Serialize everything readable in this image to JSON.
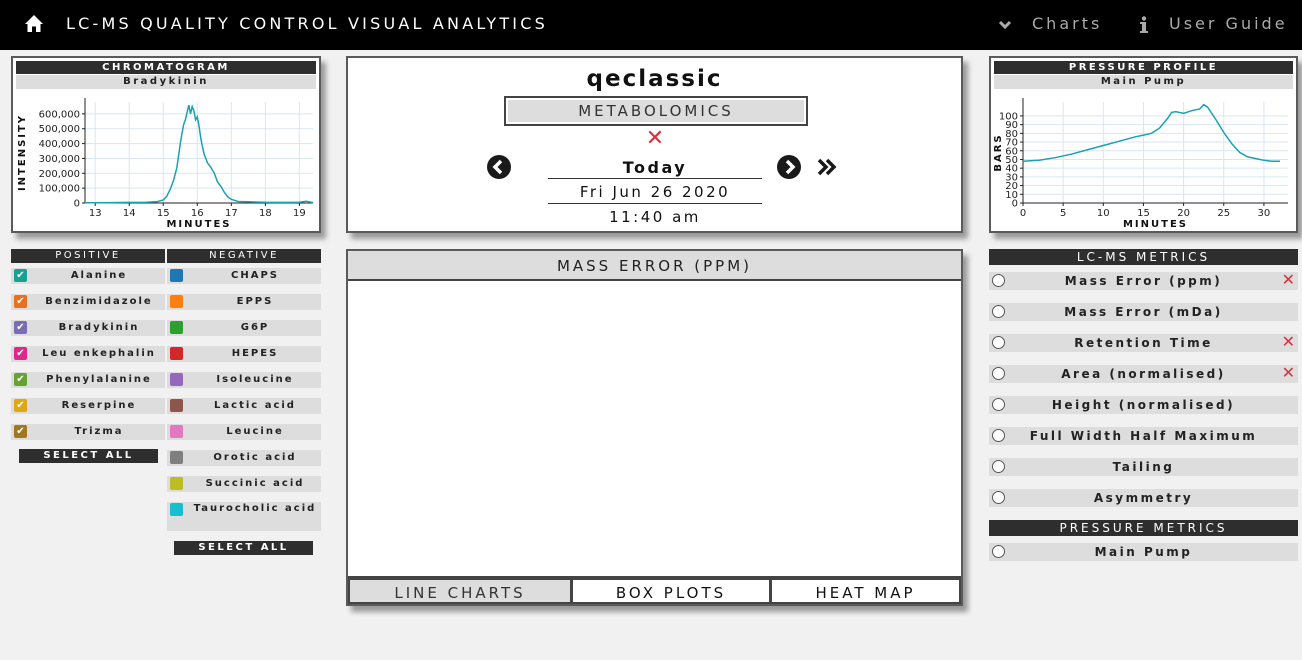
{
  "topbar": {
    "title": "LC-MS QUALITY CONTROL VISUAL ANALYTICS",
    "charts_label": "Charts",
    "guide_label": "User Guide"
  },
  "chromatogram": {
    "title": "CHROMATOGRAM",
    "compound": "Bradykinin",
    "ylabel": "INTENSITY",
    "xlabel": "MINUTES"
  },
  "pressure": {
    "title": "PRESSURE PROFILE",
    "subtitle": "Main Pump",
    "ylabel": "BARS",
    "xlabel": "MINUTES"
  },
  "run": {
    "name": "qeclassic",
    "mode": "METABOLOMICS",
    "day": "Today",
    "date": "Fri Jun 26 2020",
    "time": "11:40 am"
  },
  "lists": {
    "positive_title": "POSITIVE",
    "negative_title": "NEGATIVE",
    "select_all": "SELECT ALL",
    "positive": [
      {
        "label": "Alanine",
        "color": "#17a195",
        "checked": true
      },
      {
        "label": "Benzimidazole",
        "color": "#e8701e",
        "checked": true
      },
      {
        "label": "Bradykinin",
        "color": "#7a6cb5",
        "checked": true
      },
      {
        "label": "Leu enkephalin",
        "color": "#e0288c",
        "checked": true
      },
      {
        "label": "Phenylalanine",
        "color": "#66a232",
        "checked": true
      },
      {
        "label": "Reserpine",
        "color": "#e2a614",
        "checked": true
      },
      {
        "label": "Trizma",
        "color": "#a2781e",
        "checked": true
      }
    ],
    "negative": [
      {
        "label": "CHAPS",
        "color": "#1f77b4"
      },
      {
        "label": "EPPS",
        "color": "#ff7f0e"
      },
      {
        "label": "G6P",
        "color": "#2ca02c"
      },
      {
        "label": "HEPES",
        "color": "#d62728"
      },
      {
        "label": "Isoleucine",
        "color": "#9467bd"
      },
      {
        "label": "Lactic acid",
        "color": "#8c564b"
      },
      {
        "label": "Leucine",
        "color": "#e377c2"
      },
      {
        "label": "Orotic acid",
        "color": "#7f7f7f"
      },
      {
        "label": "Succinic acid",
        "color": "#bcbd22"
      },
      {
        "label": "Taurocholic acid",
        "color": "#17becf"
      }
    ]
  },
  "mass_error": {
    "title": "MASS ERROR (PPM)",
    "tabs": [
      "LINE CHARTS",
      "BOX PLOTS",
      "HEAT MAP"
    ],
    "active_tab": "LINE CHARTS"
  },
  "metrics": {
    "title": "LC-MS METRICS",
    "items": [
      {
        "label": "Mass Error (ppm)",
        "flag": true
      },
      {
        "label": "Mass Error (mDa)",
        "flag": false
      },
      {
        "label": "Retention Time",
        "flag": true
      },
      {
        "label": "Area (normalised)",
        "flag": true
      },
      {
        "label": "Height (normalised)",
        "flag": false
      },
      {
        "label": "Full Width Half Maximum",
        "flag": false
      },
      {
        "label": "Tailing",
        "flag": false
      },
      {
        "label": "Asymmetry",
        "flag": false
      }
    ],
    "pressure_title": "PRESSURE METRICS",
    "pressure_items": [
      {
        "label": "Main Pump"
      }
    ]
  },
  "chart_data": [
    {
      "type": "line",
      "title": "CHROMATOGRAM",
      "subtitle": "Bradykinin",
      "xlabel": "MINUTES",
      "ylabel": "INTENSITY",
      "xlim": [
        12.7,
        19.4
      ],
      "ylim": [
        0,
        680000
      ],
      "xticks": [
        13,
        14,
        15,
        16,
        17,
        18,
        19
      ],
      "yticks": [
        0,
        100000,
        200000,
        300000,
        400000,
        500000,
        600000
      ],
      "yticklabels": [
        "0",
        "100,000",
        "200,000",
        "300,000",
        "400,000",
        "500,000",
        "600,000"
      ],
      "color": "#1aa1b2",
      "grid": true,
      "series": [
        {
          "x": [
            12.7,
            13.0,
            13.5,
            14.0,
            14.5,
            14.8,
            15.0,
            15.1,
            15.2,
            15.3,
            15.4,
            15.45,
            15.5,
            15.55,
            15.6,
            15.65,
            15.7,
            15.75,
            15.8,
            15.85,
            15.9,
            15.95,
            16.0,
            16.05,
            16.1,
            16.15,
            16.2,
            16.3,
            16.4,
            16.5,
            16.6,
            16.7,
            16.8,
            16.9,
            17.0,
            17.2,
            17.5,
            18.0,
            18.5,
            19.0,
            19.2,
            19.4
          ],
          "y": [
            2000,
            2000,
            3000,
            4000,
            5000,
            8000,
            20000,
            45000,
            90000,
            150000,
            240000,
            320000,
            400000,
            470000,
            530000,
            560000,
            610000,
            660000,
            600000,
            650000,
            620000,
            560000,
            580000,
            520000,
            440000,
            380000,
            330000,
            270000,
            240000,
            200000,
            140000,
            110000,
            70000,
            40000,
            25000,
            10000,
            8000,
            5000,
            4000,
            5000,
            12000,
            3000
          ]
        }
      ]
    },
    {
      "type": "line",
      "title": "PRESSURE PROFILE",
      "subtitle": "Main Pump",
      "xlabel": "MINUTES",
      "ylabel": "BARS",
      "xlim": [
        0,
        33
      ],
      "ylim": [
        0,
        116
      ],
      "xticks": [
        0,
        5,
        10,
        15,
        20,
        25,
        30
      ],
      "yticks": [
        0,
        10,
        20,
        30,
        40,
        50,
        60,
        70,
        80,
        90,
        100
      ],
      "color": "#1aa1b2",
      "grid": true,
      "series": [
        {
          "x": [
            0,
            2,
            4,
            6,
            8,
            10,
            12,
            14,
            15,
            16,
            17,
            18,
            18.5,
            19,
            20,
            21,
            22,
            22.5,
            23,
            24,
            25,
            26,
            27,
            28,
            29,
            30,
            31,
            32
          ],
          "y": [
            48,
            49,
            52,
            56,
            61,
            66,
            71,
            76,
            78,
            80,
            86,
            97,
            104,
            105,
            103,
            106,
            108,
            113,
            110,
            96,
            81,
            68,
            58,
            53,
            51,
            49,
            48,
            48
          ]
        }
      ]
    }
  ]
}
